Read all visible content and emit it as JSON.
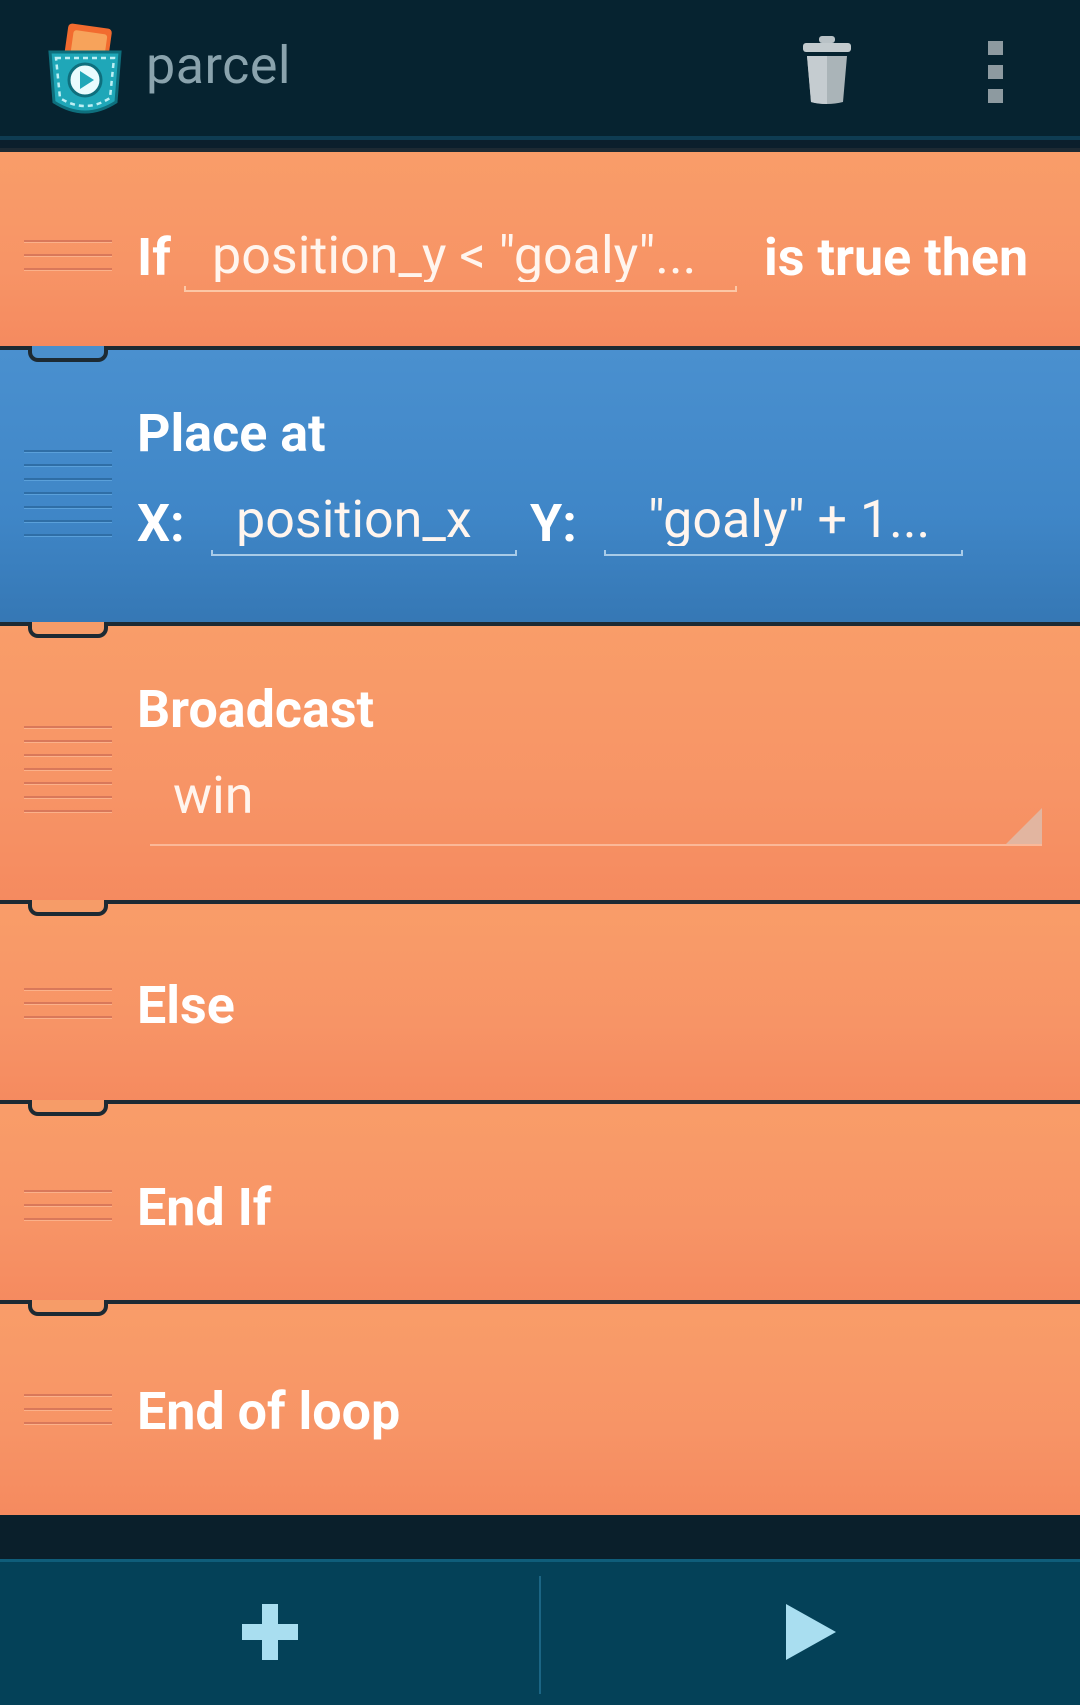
{
  "app": {
    "title": "parcel"
  },
  "actionbar": {
    "delete_icon": "trash-icon",
    "overflow_icon": "overflow-menu-icon"
  },
  "bricks": {
    "if_brick": {
      "label_if": "If",
      "condition": "position_y < \"goaly\"...",
      "label_then": "is true then"
    },
    "place_at_brick": {
      "title": "Place at",
      "x_label": "X:",
      "x_value": "position_x",
      "y_label": "Y:",
      "y_value": "\"goaly\" + 1..."
    },
    "broadcast_brick": {
      "title": "Broadcast",
      "message": "win"
    },
    "else_brick": {
      "title": "Else"
    },
    "end_if_brick": {
      "title": "End If"
    },
    "end_loop_brick": {
      "title": "End of loop"
    }
  },
  "bottombar": {
    "add_icon": "plus-icon",
    "play_icon": "play-icon"
  },
  "colors": {
    "control_brick": "#f79466",
    "motion_brick": "#3f86c7",
    "actionbar": "#062330",
    "bottombar": "#044158"
  }
}
